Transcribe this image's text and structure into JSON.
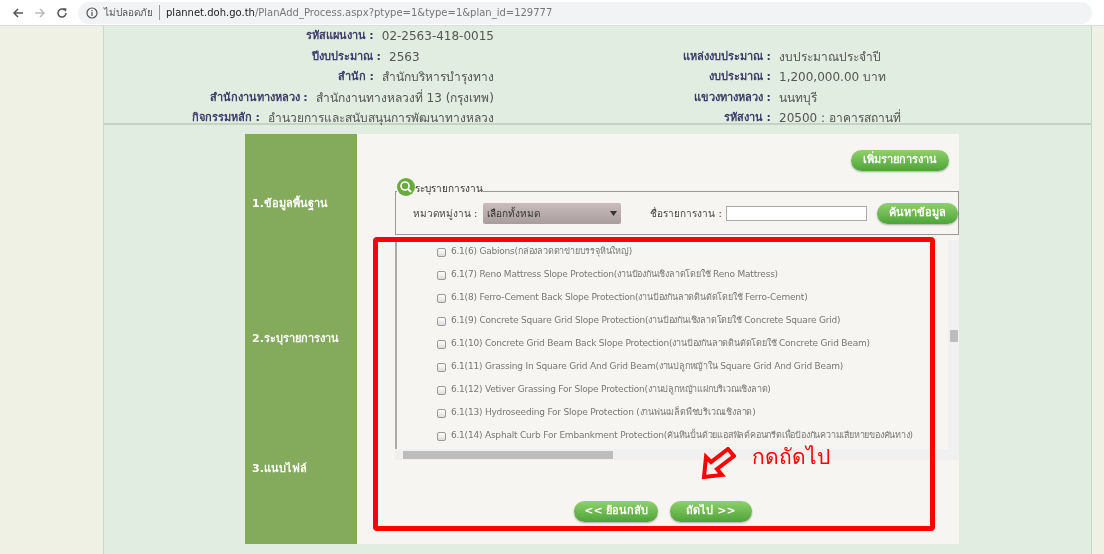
{
  "browser": {
    "security_label": "ไม่ปลอดภัย",
    "url_host": "plannet.doh.go.th",
    "url_path": "/PlanAdd_Process.aspx?ptype=1&type=1&plan_id=129777"
  },
  "info_rows": [
    {
      "left": {
        "label": "รหัสแผนงาน :",
        "value": "02-2563-418-0015"
      }
    },
    {
      "left": {
        "label": "ปีงบประมาณ :",
        "value": "2563"
      },
      "right": {
        "label": "แหล่งงบประมาณ :",
        "value": "งบประมาณประจำปี"
      }
    },
    {
      "left": {
        "label": "สำนัก :",
        "value": "สำนักบริหารบำรุงทาง"
      },
      "right": {
        "label": "งบประมาณ :",
        "value": "1,200,000.00 บาท"
      }
    },
    {
      "left": {
        "label": "สำนักงานทางหลวง :",
        "value": "สำนักงานทางหลวงที่ 13 (กรุงเทพ)"
      },
      "right": {
        "label": "แขวงทางหลวง :",
        "value": "นนทบุรี"
      }
    },
    {
      "left": {
        "label": "กิจกรรมหลัก :",
        "value": "อำนวยการและสนับสนุนการพัฒนาทางหลวง"
      },
      "right": {
        "label": "รหัสงาน :",
        "value": "20500 : อาคารสถานที่"
      }
    }
  ],
  "steps": [
    {
      "label": "1.ข้อมูลพื้นฐาน"
    },
    {
      "label": "2.ระบุรายการงาน"
    },
    {
      "label": "3.แนบไฟล์"
    }
  ],
  "add_button": "เพิ่มรายการงาน",
  "search": {
    "legend": "ระบุรายการงาน",
    "category_label": "หมวดหมู่งาน :",
    "category_value": "เลือกทั้งหมด",
    "name_label": "ชื่อรายการงาน :",
    "button": "ค้นหาข้อมูล"
  },
  "items": [
    {
      "label": "6.1(6) Gabions(กล่องลวดตาข่ายบรรจุหินใหญ่)",
      "checked": false
    },
    {
      "label": "6.1(7) Reno Mattress Slope Protection(งานป้องกันเชิงลาดโดยใช้ Reno Mattress)",
      "checked": false
    },
    {
      "label": "6.1(8) Ferro-Cement Back Slope Protection(งานป้องกันลาดดินตัดโดยใช้ Ferro-Cement)",
      "checked": false
    },
    {
      "label": "6.1(9) Concrete Square Grid Slope Protection(งานป้องกันเชิงลาดโดยใช้ Concrete Square Grid)",
      "checked": false
    },
    {
      "label": "6.1(10) Concrete Grid Beam Back Slope Protection(งานป้องกันลาดดินตัดโดยใช้ Concrete Grid Beam)",
      "checked": false
    },
    {
      "label": "6.1(11) Grassing In Square Grid And Grid Beam(งานปลูกหญ้าใน Square Grid And Grid Beam)",
      "checked": false
    },
    {
      "label": "6.1(12) Vetiver Grassing For Slope Protection(งานปลูกหญ้าแฝกบริเวณเชิงลาด)",
      "checked": false
    },
    {
      "label": "6.1(13) Hydroseeding For Slope Protection (งานพ่นเมล็ดพืชบริเวณเชิงลาด)",
      "checked": false
    },
    {
      "label": "6.1(14) Asphalt Curb For Embankment Protection(คันหินปั้นด้วยแอสฟัลต์คอนกรีตเพื่อป้องกันความเสียหายของคันทาง)",
      "checked": false
    }
  ],
  "nav": {
    "back": "<< ย้อนกลับ",
    "next": "ถัดไป >>"
  },
  "annotation": {
    "text": "กดถัดไป"
  }
}
